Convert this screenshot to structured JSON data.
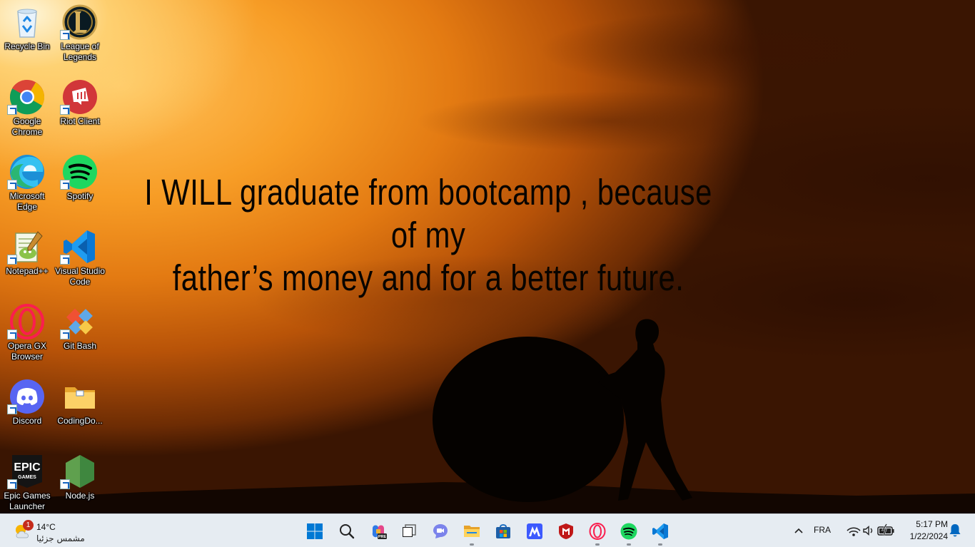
{
  "wallpaper": {
    "quote_line1": "I WILL graduate from bootcamp , because of my",
    "quote_line2": "father’s money and for a better future."
  },
  "desktop_icons": [
    {
      "id": "recycle-bin",
      "label": "Recycle Bin",
      "icon": "recycle-bin-icon"
    },
    {
      "id": "league-of-legends",
      "label": "League of Legends",
      "icon": "league-of-legends-icon"
    },
    {
      "id": "google-chrome",
      "label": "Google Chrome",
      "icon": "chrome-icon"
    },
    {
      "id": "riot-client",
      "label": "Riot Client",
      "icon": "riot-client-icon"
    },
    {
      "id": "microsoft-edge",
      "label": "Microsoft Edge",
      "icon": "edge-icon"
    },
    {
      "id": "spotify",
      "label": "Spotify",
      "icon": "spotify-icon"
    },
    {
      "id": "notepadpp",
      "label": "Notepad++",
      "icon": "notepadpp-icon"
    },
    {
      "id": "vscode",
      "label": "Visual Studio Code",
      "icon": "vscode-icon"
    },
    {
      "id": "opera-gx",
      "label": "Opera GX Browser",
      "icon": "opera-gx-icon"
    },
    {
      "id": "git-bash",
      "label": "Git Bash",
      "icon": "git-bash-icon"
    },
    {
      "id": "discord",
      "label": "Discord",
      "icon": "discord-icon"
    },
    {
      "id": "codingdo-folder",
      "label": "CodingDo...",
      "icon": "folder-icon"
    },
    {
      "id": "epic-games",
      "label": "Epic Games Launcher",
      "icon": "epic-games-icon"
    },
    {
      "id": "nodejs",
      "label": "Node.js",
      "icon": "nodejs-icon"
    }
  ],
  "epic_logo_text": "EPIC",
  "epic_logo_sub": "GAMES",
  "taskbar": {
    "weather": {
      "temp": "14°C",
      "condition": "مشمس جزئيا",
      "badge": "1",
      "icon": "partly-sunny-icon"
    },
    "apps": [
      {
        "id": "start",
        "icon": "windows-start-icon",
        "running": false
      },
      {
        "id": "search",
        "icon": "search-icon",
        "running": false
      },
      {
        "id": "copilot",
        "icon": "copilot-pre-icon",
        "running": false
      },
      {
        "id": "task-view",
        "icon": "task-view-icon",
        "running": false
      },
      {
        "id": "teams-chat",
        "icon": "teams-chat-icon",
        "running": false
      },
      {
        "id": "file-explorer",
        "icon": "file-explorer-icon",
        "running": true
      },
      {
        "id": "ms-store",
        "icon": "microsoft-store-icon",
        "running": false
      },
      {
        "id": "app-m",
        "icon": "blue-m-app-icon",
        "running": false
      },
      {
        "id": "mcafee",
        "icon": "mcafee-icon",
        "running": false
      },
      {
        "id": "opera-gx",
        "icon": "opera-gx-icon",
        "running": true
      },
      {
        "id": "spotify",
        "icon": "spotify-icon",
        "running": true
      },
      {
        "id": "vscode",
        "icon": "vscode-icon",
        "running": true
      }
    ],
    "copilot_badge": "PRE",
    "language": "FRA",
    "time": "5:17 PM",
    "date": "1/22/2024",
    "colors": {
      "accent": "#0067c0",
      "badge": "#c42b1c"
    }
  }
}
